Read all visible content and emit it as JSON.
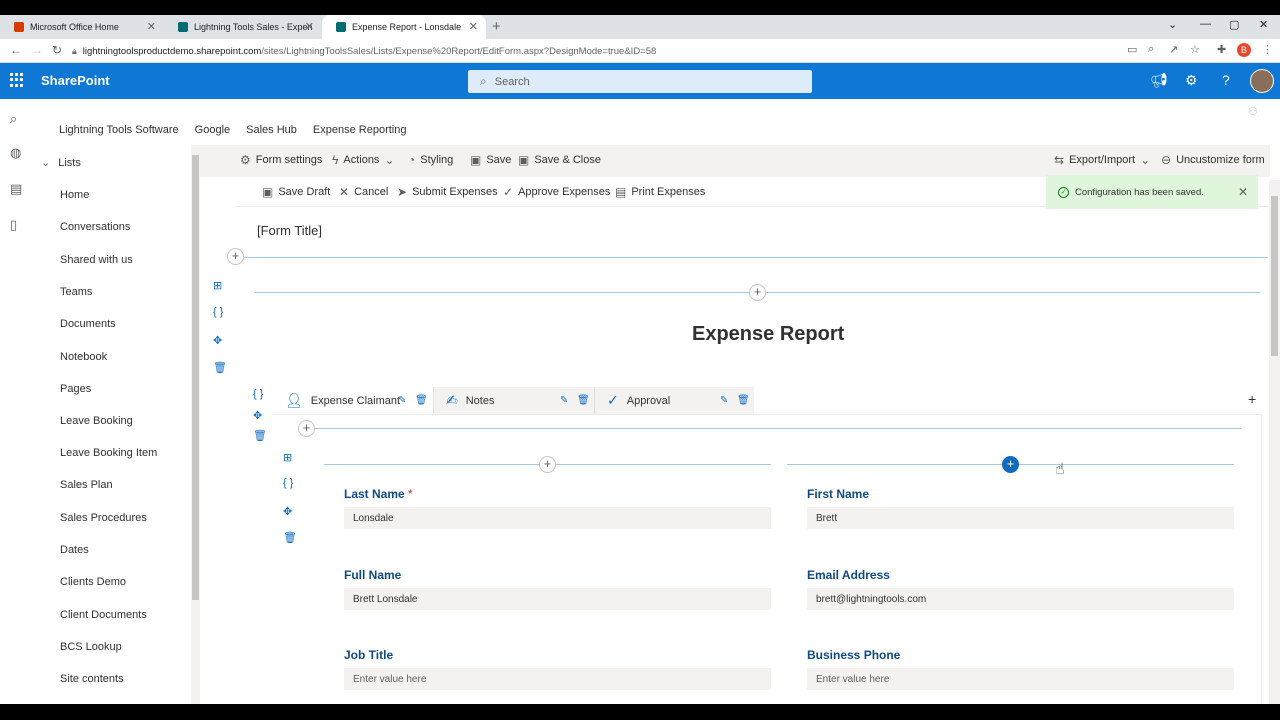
{
  "browser": {
    "tabs": [
      {
        "title": "Microsoft Office Home",
        "favicon_color": "#d83b01"
      },
      {
        "title": "Lightning Tools Sales - Expense Re",
        "favicon_color": "#036c70"
      },
      {
        "title": "Expense Report - Lonsdale",
        "favicon_color": "#036c70"
      }
    ],
    "url_host": "lightningtoolsproductdemo.sharepoint.com",
    "url_path": "/sites/LightningToolsSales/Lists/Expense%20Report/EditForm.aspx?DesignMode=true&ID=58",
    "profile_initial": "B"
  },
  "suite": {
    "brand": "SharePoint",
    "search_placeholder": "Search"
  },
  "hub_nav": [
    "Lightning Tools Software",
    "Google",
    "Sales Hub",
    "Expense Reporting"
  ],
  "sidenav": {
    "heading": "Lists",
    "items": [
      "Home",
      "Conversations",
      "Shared with us",
      "Teams",
      "Documents",
      "Notebook",
      "Pages",
      "Leave Booking",
      "Leave Booking Item",
      "Sales Plan",
      "Sales Procedures",
      "Dates",
      "Clients Demo",
      "Client Documents",
      "BCS Lookup",
      "Site contents"
    ]
  },
  "designer_toolbar": {
    "form_settings": "Form settings",
    "actions": "Actions",
    "styling": "Styling",
    "save": "Save",
    "save_close": "Save & Close",
    "export_import": "Export/Import",
    "uncustomize": "Uncustomize form"
  },
  "form_toolbar": {
    "save_draft": "Save Draft",
    "cancel": "Cancel",
    "submit": "Submit Expenses",
    "approve": "Approve Expenses",
    "print": "Print Expenses"
  },
  "toast": {
    "message": "Configuration has been saved."
  },
  "form": {
    "title_placeholder": "[Form Title]",
    "heading": "Expense Report",
    "tabs": [
      "Expense Claimant",
      "Notes",
      "Approval"
    ],
    "fields": {
      "last_name": {
        "label": "Last Name",
        "value": "Lonsdale",
        "required": "*"
      },
      "first_name": {
        "label": "First Name",
        "value": "Brett"
      },
      "full_name": {
        "label": "Full Name",
        "value": "Brett Lonsdale"
      },
      "email": {
        "label": "Email Address",
        "value": "brett@lightningtools.com"
      },
      "job_title": {
        "label": "Job Title",
        "placeholder": "Enter value here"
      },
      "business_phone": {
        "label": "Business Phone",
        "placeholder": "Enter value here"
      }
    }
  },
  "colors": {
    "suite_blue": "#0f78d4",
    "accent": "#0f6cbd",
    "toast_bg": "#dff6dd",
    "required": "#c4314b"
  }
}
